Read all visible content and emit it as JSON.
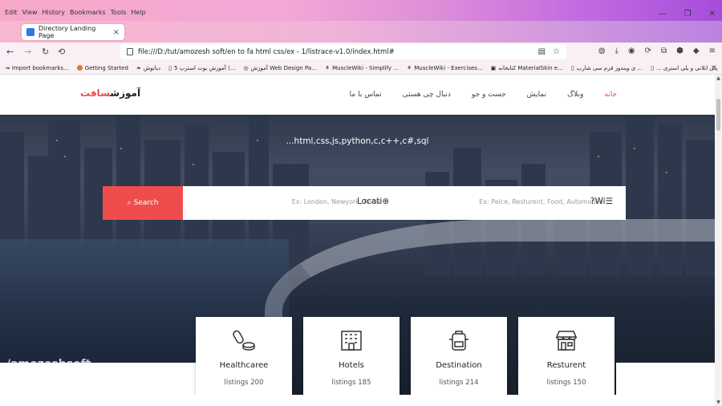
{
  "menu": [
    "Edit",
    "View",
    "History",
    "Bookmarks",
    "Tools",
    "Help"
  ],
  "tab": {
    "title": "Directory Landing Page",
    "close": "×"
  },
  "newtab_symbol": "+",
  "url": "file:///D:/tut/amozesh soft/en to fa html css/ex - 1/listrace-v1.0/index.html#",
  "bookmarks": [
    "Import bookmarks...",
    "Getting Started",
    "دیانوش",
    "آموزش بوت استرپ 5 (...",
    "آموزش Web Design Pa...",
    "MuscleWiki - Simplify ...",
    "MuscleWiki - Exercises...",
    "کتابخانه MaterialSkin e...",
    "ی ویندوز فرم سی شارپ ...",
    "... پلی اتلانی و پلی استری"
  ],
  "site": {
    "logo_main": "آموزش",
    "logo_accent": "سافت",
    "nav": [
      "خانه",
      "وبلاگ",
      "نمایش",
      "جست و جو",
      "دنبال چی هستی",
      "تماس با ما"
    ],
    "subtitle": "...html,css,js,python,c,c++,c#,sql",
    "search_button": "Search",
    "location_placeholder": "Ex: London, Newyork, Rome",
    "location_label": "Locati",
    "what_placeholder": "Ex: Palce, Resturent, Food, Automobile",
    "what_label": "?Wi"
  },
  "cards": [
    {
      "title": "Healthcaree",
      "count": "listings 200",
      "icon": "pills-icon"
    },
    {
      "title": "Hotels",
      "count": "listings 185",
      "icon": "building-icon"
    },
    {
      "title": "Destination",
      "count": "listings 214",
      "icon": "backpack-icon"
    },
    {
      "title": "Resturent",
      "count": "listings 150",
      "icon": "store-icon"
    }
  ],
  "watermark": "/amozeshsoft",
  "colors": {
    "accent": "#ef4d4d",
    "brand_text": "#e94b4b"
  }
}
